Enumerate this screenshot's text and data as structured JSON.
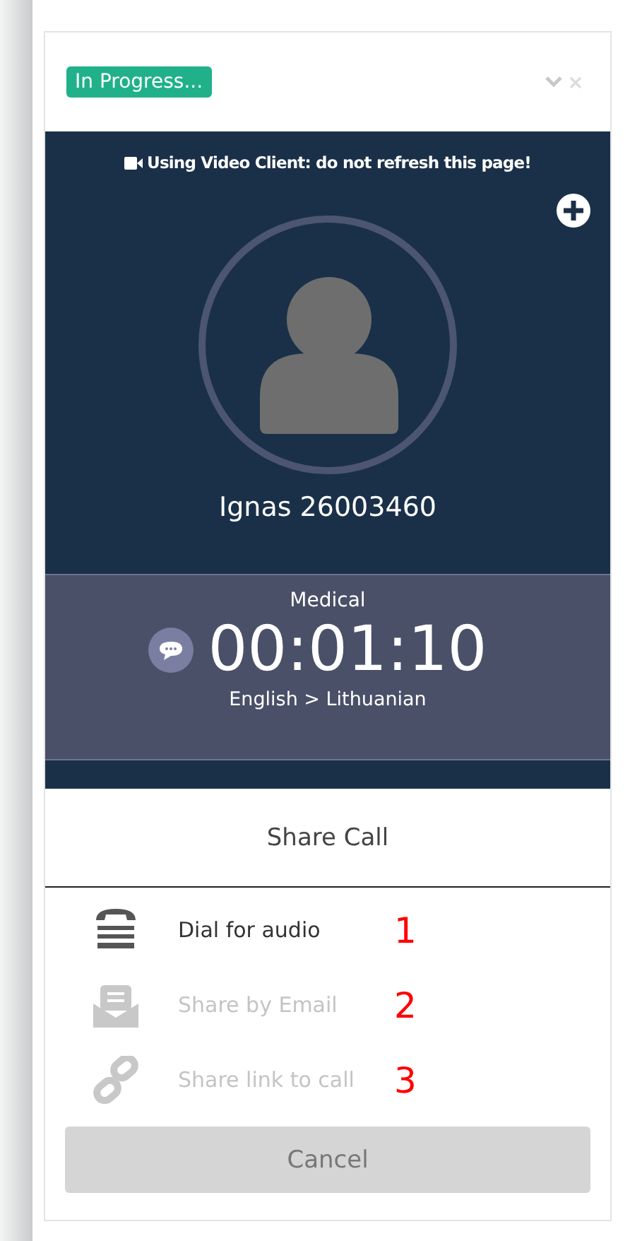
{
  "status_badge": "In Progress...",
  "notice": "Using Video Client: do not refresh this page!",
  "caller": {
    "name": "Ignas 26003460"
  },
  "call": {
    "category": "Medical",
    "timer": "00:01:10",
    "languages": "English > Lithuanian"
  },
  "share_sheet": {
    "title": "Share Call",
    "items": [
      {
        "kind": "phone",
        "label": "Dial for audio",
        "disabled": false,
        "marker": "1"
      },
      {
        "kind": "email",
        "label": "Share by Email",
        "disabled": true,
        "marker": "2"
      },
      {
        "kind": "link",
        "label": "Share link to call",
        "disabled": true,
        "marker": "3"
      }
    ],
    "cancel": "Cancel"
  }
}
